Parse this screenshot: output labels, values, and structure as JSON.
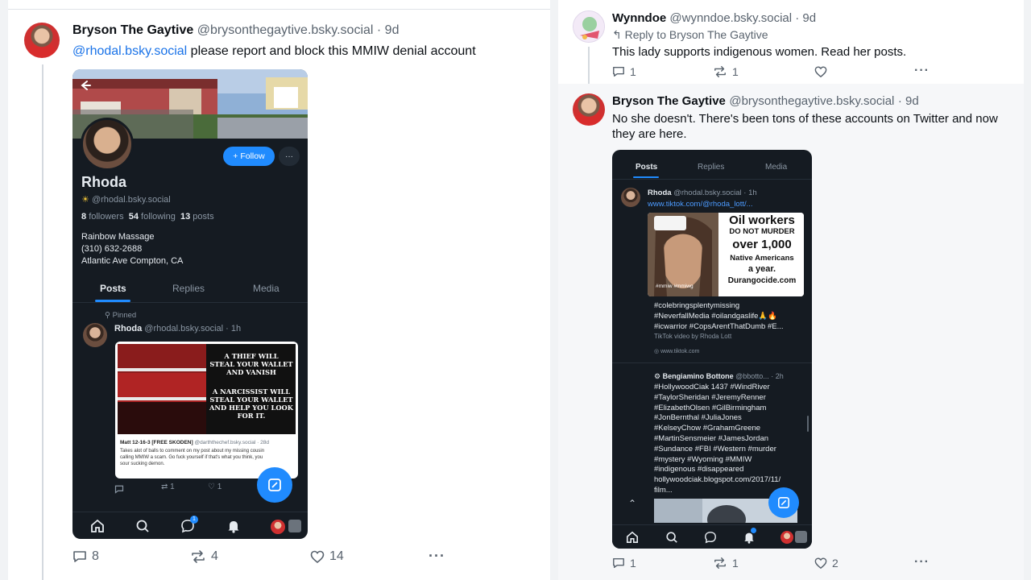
{
  "left_post": {
    "author_name": "Bryson The Gaytive",
    "author_handle": "@brysonthegaytive.bsky.social",
    "age": "· 9d",
    "mention": "@rhodal.bsky.social",
    "text": " please report and block this MMIW denial account",
    "actions": {
      "replies": "8",
      "reposts": "4",
      "likes": "14"
    }
  },
  "left_phone": {
    "profile_name": "Rhoda",
    "profile_handle": "@rhodal.bsky.social",
    "follow_label": "+ Follow",
    "followers_count": "8",
    "followers_label": "followers",
    "following_count": "54",
    "following_label": "following",
    "posts_count": "13",
    "posts_label": "posts",
    "bio": [
      "Rainbow Massage",
      "(310) 632-2688",
      "Atlantic Ave Compton, CA"
    ],
    "tabs": [
      "Posts",
      "Replies",
      "Media"
    ],
    "pinned_label": "Pinned",
    "post_name": "Rhoda",
    "post_handle": "@rhodal.bsky.social · 1h",
    "meme_lines": [
      "A THIEF WILL",
      "STEAL YOUR WALLET",
      "AND VANISH",
      "A NARCISSIST WILL",
      "STEAL YOUR WALLET",
      "AND HELP YOU LOOK",
      "FOR IT."
    ],
    "quote_author": "Matt 12-16-3 [FREE SKODEN]",
    "quote_handle": "@darththechef.bsky.social · 28d",
    "quote_text": [
      "Takes alot of balls to comment on my post about my missing cousin",
      "calling MMIW a scam. Go fuck yourself if that's what you think, you",
      "sour sucking demon."
    ],
    "post_actions": {
      "replies": "",
      "reposts": "1",
      "likes": "1"
    },
    "chat_badge": "1"
  },
  "right_reply": {
    "author_name": "Wynndoe",
    "author_handle": "@wynndoe.bsky.social",
    "age": "· 9d",
    "reply_to": "Reply to Bryson The Gaytive",
    "text": "This lady supports indigenous women. Read her posts.",
    "actions": {
      "replies": "1",
      "reposts": "1",
      "likes": ""
    }
  },
  "right_post": {
    "author_name": "Bryson The Gaytive",
    "author_handle": "@brysonthegaytive.bsky.social",
    "age": "· 9d",
    "text_line1": "No she doesn't. There's been tons of these accounts on Twitter and now",
    "text_line2": "they are here.",
    "actions": {
      "replies": "1",
      "reposts": "1",
      "likes": "2"
    }
  },
  "right_phone": {
    "tabs": [
      "Posts",
      "Replies",
      "Media"
    ],
    "post_name": "Rhoda",
    "post_handle": "@rhodal.bsky.social · 1h",
    "post_link": "www.tiktok.com/@rhoda_lott/...",
    "image_lines": [
      "Oil workers",
      "DO NOT MURDER",
      "over 1,000",
      "Native Americans",
      "a year.",
      "Durangocide.com"
    ],
    "image_caption": "#mmiw #mmiwg",
    "hashtags1": [
      "#colebringsplentymissing",
      "#NeverfallMedia #oilandgaslife🙏🔥",
      "#icwarrior #CopsArentThatDumb #E..."
    ],
    "embed_title": "TikTok video by Rhoda Lott",
    "embed_domain": "www.tiktok.com",
    "post2_name": "Bengiamino Bottone",
    "post2_handle": "@bbotto...",
    "post2_age": "· 2h",
    "hashtags2": [
      "#HollywoodCiak 1437 #WindRiver",
      "#TaylorSheridan #JeremyRenner",
      "#ElizabethOlsen #GilBirmingham",
      "#JonBernthal #JuliaJones",
      "#KelseyChow #GrahamGreene",
      "#MartinSensmeier #JamesJordan",
      "#Sundance #FBI #Western #murder",
      "#mystery #Wyoming #MMIW",
      "#indigenous #disappeared",
      "hollywoodciak.blogspot.com/2017/11/",
      "film..."
    ]
  },
  "colors": {
    "accent": "#208bfe",
    "link": "#1a73e8",
    "phone_bg": "#151b22"
  },
  "icons": [
    "reply-icon",
    "repost-icon",
    "like-icon",
    "more-icon",
    "compose-icon",
    "home-icon",
    "search-icon",
    "chat-icon",
    "bell-icon",
    "back-icon",
    "pin-icon"
  ]
}
